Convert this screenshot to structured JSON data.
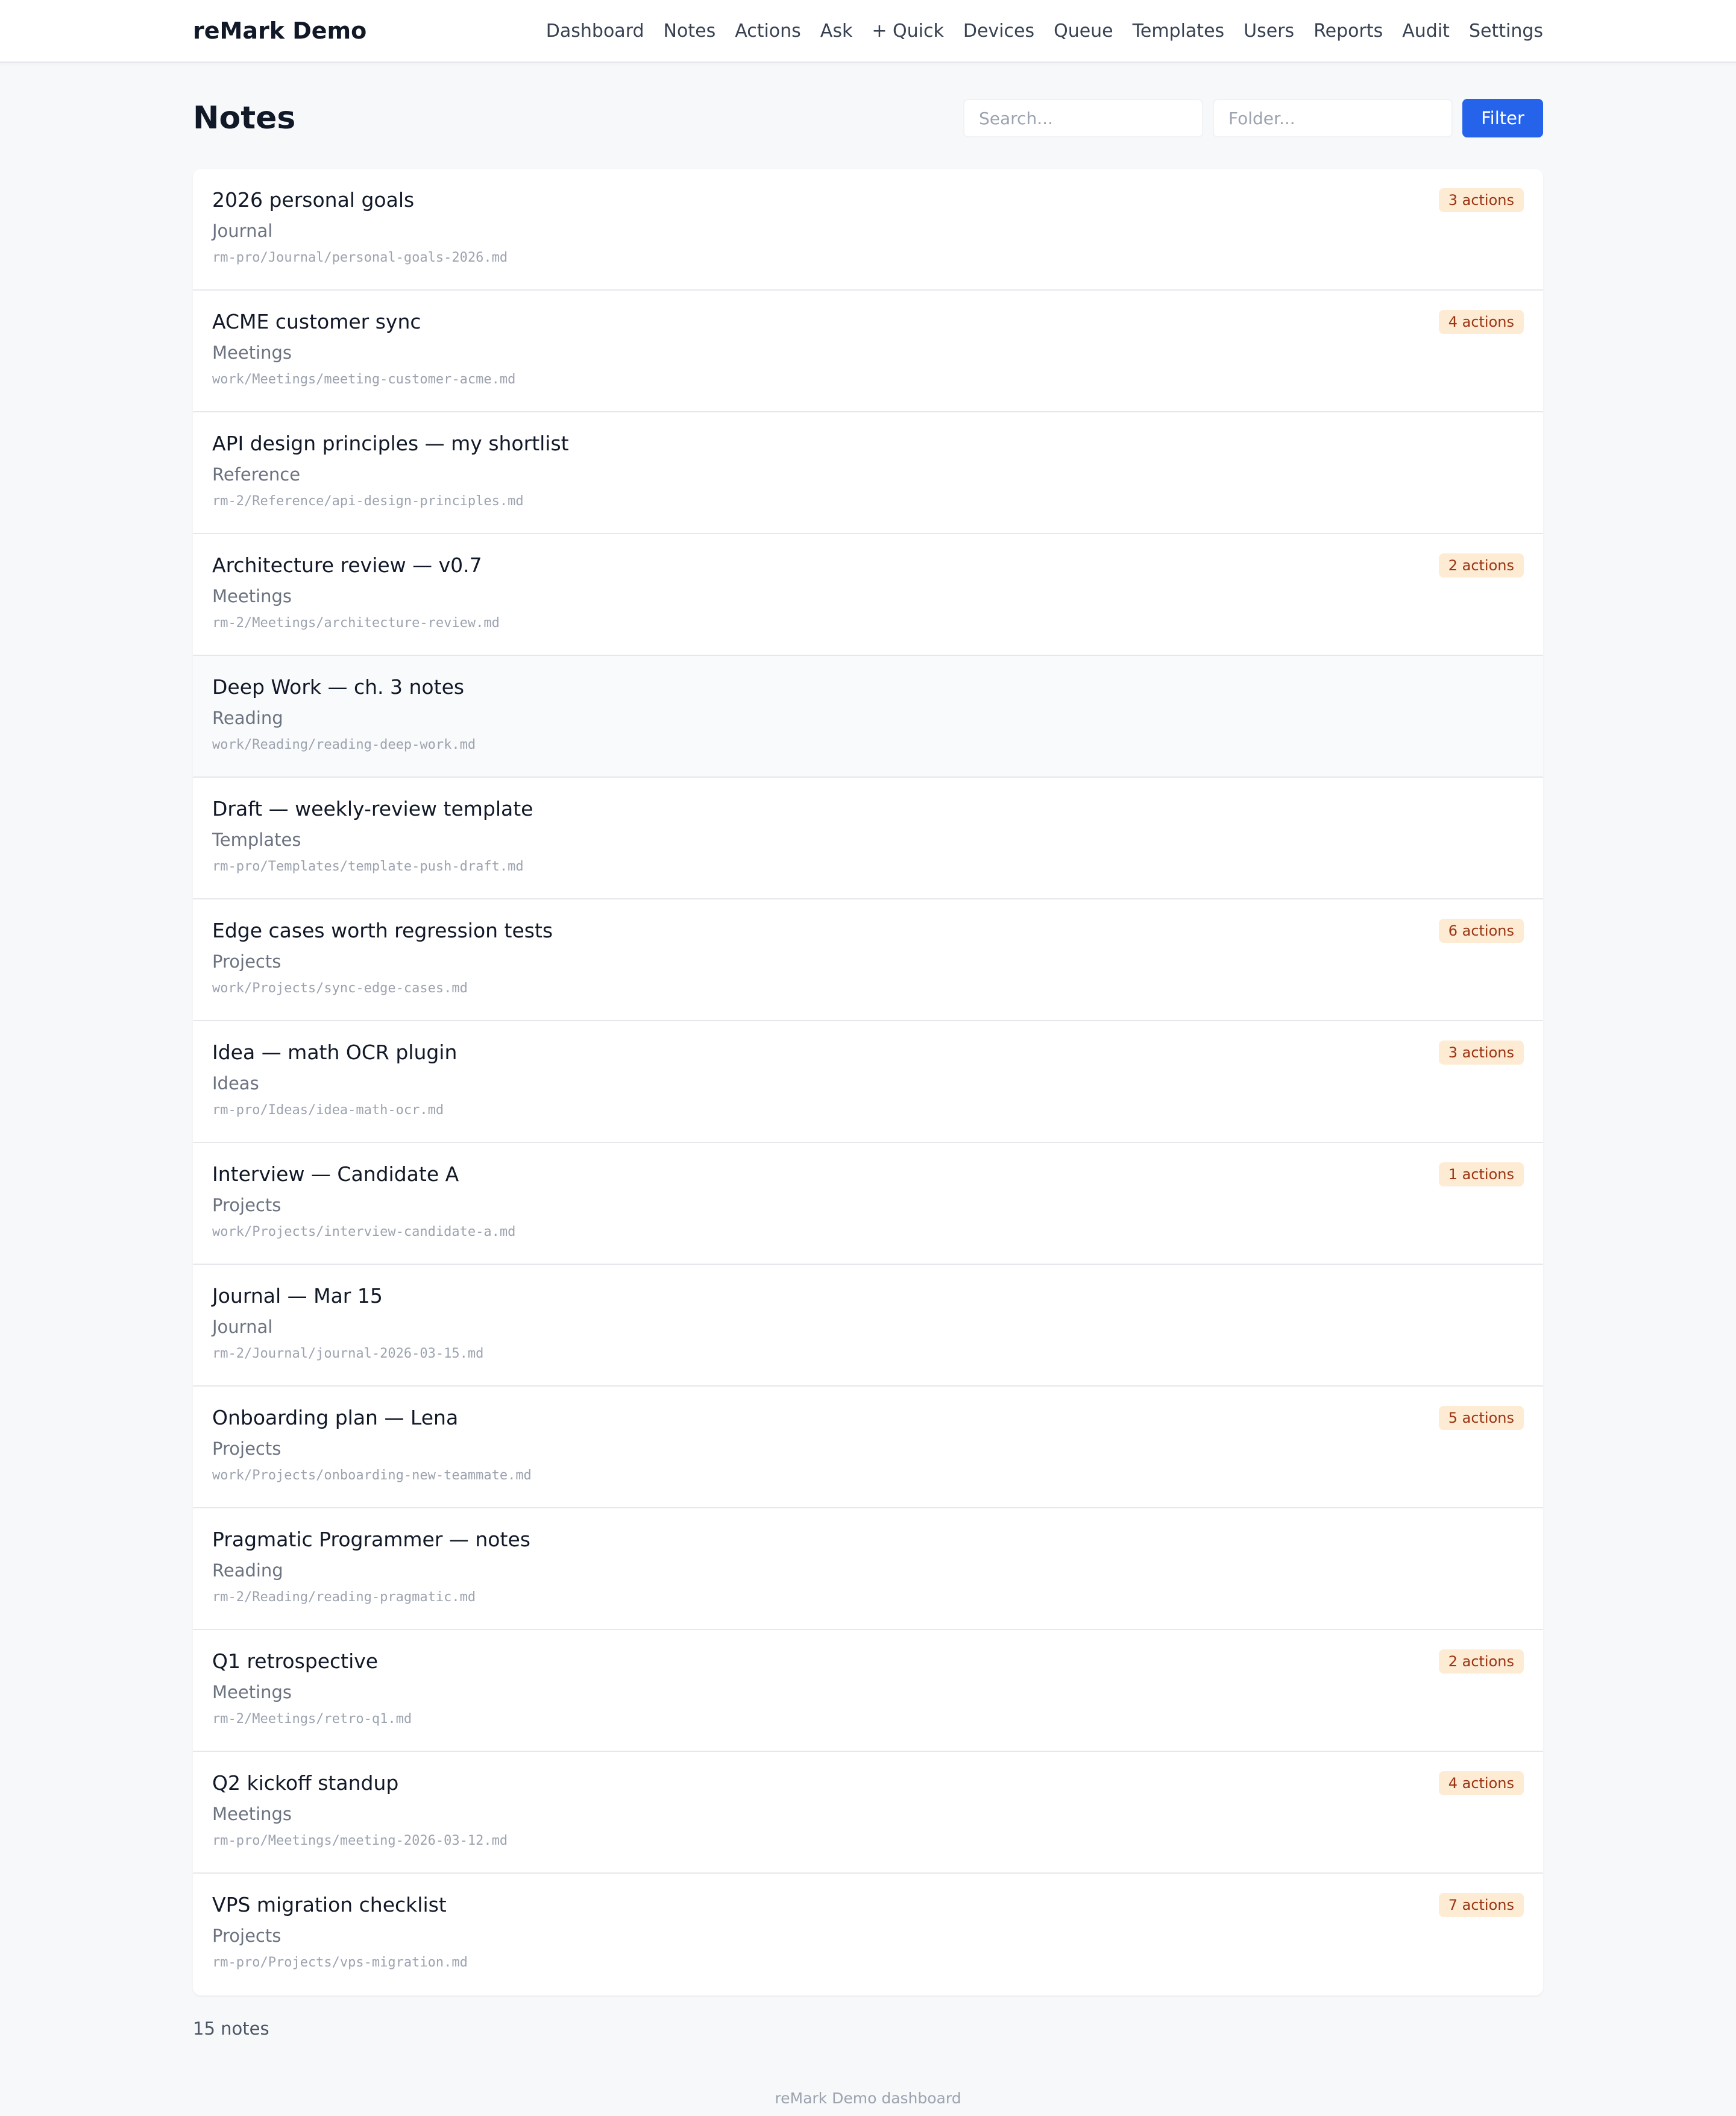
{
  "app": {
    "brand": "reMark Demo"
  },
  "nav": [
    {
      "label": "Dashboard"
    },
    {
      "label": "Notes"
    },
    {
      "label": "Actions"
    },
    {
      "label": "Ask"
    },
    {
      "label": "+ Quick"
    },
    {
      "label": "Devices"
    },
    {
      "label": "Queue"
    },
    {
      "label": "Templates"
    },
    {
      "label": "Users"
    },
    {
      "label": "Reports"
    },
    {
      "label": "Audit"
    },
    {
      "label": "Settings"
    }
  ],
  "page": {
    "title": "Notes",
    "search_placeholder": "Search...",
    "search_value": "",
    "folder_placeholder": "Folder...",
    "folder_value": "",
    "filter_label": "Filter"
  },
  "notes": [
    {
      "title": "2026 personal goals",
      "folder": "Journal",
      "path": "rm-pro/Journal/personal-goals-2026.md",
      "badge": "3 actions"
    },
    {
      "title": "ACME customer sync",
      "folder": "Meetings",
      "path": "work/Meetings/meeting-customer-acme.md",
      "badge": "4 actions"
    },
    {
      "title": "API design principles — my shortlist",
      "folder": "Reference",
      "path": "rm-2/Reference/api-design-principles.md",
      "badge": ""
    },
    {
      "title": "Architecture review — v0.7",
      "folder": "Meetings",
      "path": "rm-2/Meetings/architecture-review.md",
      "badge": "2 actions"
    },
    {
      "title": "Deep Work — ch. 3 notes",
      "folder": "Reading",
      "path": "work/Reading/reading-deep-work.md",
      "badge": ""
    },
    {
      "title": "Draft — weekly-review template",
      "folder": "Templates",
      "path": "rm-pro/Templates/template-push-draft.md",
      "badge": ""
    },
    {
      "title": "Edge cases worth regression tests",
      "folder": "Projects",
      "path": "work/Projects/sync-edge-cases.md",
      "badge": "6 actions"
    },
    {
      "title": "Idea — math OCR plugin",
      "folder": "Ideas",
      "path": "rm-pro/Ideas/idea-math-ocr.md",
      "badge": "3 actions"
    },
    {
      "title": "Interview — Candidate A",
      "folder": "Projects",
      "path": "work/Projects/interview-candidate-a.md",
      "badge": "1 actions"
    },
    {
      "title": "Journal — Mar 15",
      "folder": "Journal",
      "path": "rm-2/Journal/journal-2026-03-15.md",
      "badge": ""
    },
    {
      "title": "Onboarding plan — Lena",
      "folder": "Projects",
      "path": "work/Projects/onboarding-new-teammate.md",
      "badge": "5 actions"
    },
    {
      "title": "Pragmatic Programmer — notes",
      "folder": "Reading",
      "path": "rm-2/Reading/reading-pragmatic.md",
      "badge": ""
    },
    {
      "title": "Q1 retrospective",
      "folder": "Meetings",
      "path": "rm-2/Meetings/retro-q1.md",
      "badge": "2 actions"
    },
    {
      "title": "Q2 kickoff standup",
      "folder": "Meetings",
      "path": "rm-pro/Meetings/meeting-2026-03-12.md",
      "badge": "4 actions"
    },
    {
      "title": "VPS migration checklist",
      "folder": "Projects",
      "path": "rm-pro/Projects/vps-migration.md",
      "badge": "7 actions"
    }
  ],
  "summary": {
    "count_label": "15 notes"
  },
  "footer": {
    "text": "reMark Demo dashboard"
  },
  "colors": {
    "accent": "#2563eb",
    "badge_bg": "#feebd4",
    "badge_text": "#9a3412",
    "page_bg": "#f7f8fa"
  }
}
